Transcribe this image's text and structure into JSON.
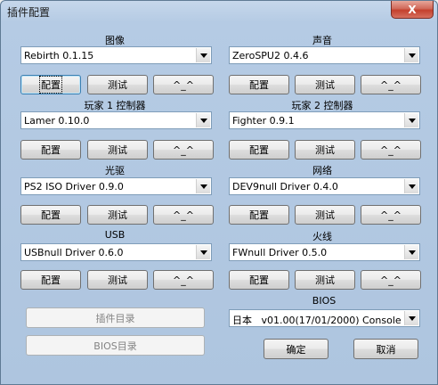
{
  "window": {
    "title": "插件配置",
    "close_label": "X"
  },
  "buttons": {
    "configure": "配置",
    "test": "测试",
    "about": "^_^"
  },
  "sections": {
    "graphics": {
      "label": "图像",
      "value": "Rebirth 0.1.15"
    },
    "sound": {
      "label": "声音",
      "value": "ZeroSPU2  0.4.6"
    },
    "controller1": {
      "label": "玩家 1 控制器",
      "value": "Lamer 0.10.0"
    },
    "controller2": {
      "label": "玩家 2 控制器",
      "value": "Fighter 0.9.1"
    },
    "cdvd": {
      "label": "光驱",
      "value": "PS2 ISO Driver 0.9.0"
    },
    "network": {
      "label": "网络",
      "value": "DEV9null Driver 0.4.0"
    },
    "usb": {
      "label": "USB",
      "value": "USBnull Driver 0.6.0"
    },
    "firewire": {
      "label": "火线",
      "value": "FWnull Driver 0.5.0"
    },
    "bios": {
      "label": "BIOS",
      "region": "日本",
      "value": "v01.00(17/01/2000) Console"
    }
  },
  "bottom": {
    "plugin_dir": "插件目录",
    "bios_dir": "BIOS目录",
    "ok": "确定",
    "cancel": "取消"
  }
}
